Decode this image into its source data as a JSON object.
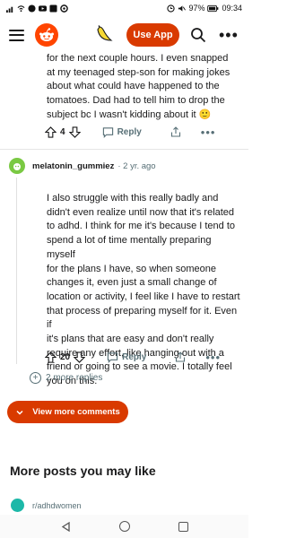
{
  "status_bar": {
    "battery": "97%",
    "time": "09:34"
  },
  "header": {
    "use_app_label": "Use App",
    "menu_icon": "hamburger-icon",
    "logo_icon": "reddit-logo",
    "search_icon": "search-icon",
    "more_icon": "more-icon"
  },
  "comment1": {
    "lines": [
      "for the next couple hours. I even snapped",
      "at my teenaged step-son for making jokes",
      "about what could have happened to the",
      "tomatoes. Dad had to tell him to drop the",
      "subject bc I wasn't kidding about it 🙂"
    ],
    "votes": "4",
    "reply_label": "Reply"
  },
  "comment2": {
    "username": "melatonin_gummiez",
    "age": "2 yr. ago",
    "lines": [
      "I also struggle with this really badly and",
      "didn't even realize until now that it's related",
      "to adhd. I think for me it's because I tend to",
      "spend a lot of time mentally preparing myself",
      "for the plans I have, so when someone",
      "changes it, even just a small change of",
      "location or activity, I feel like I have to restart",
      "that process of preparing myself for it. Even if",
      "it's plans that are easy and don't really",
      "require any effort, like hanging out with a",
      "friend or going to see a movie. I totally feel",
      "you on this."
    ],
    "votes": "20",
    "reply_label": "Reply",
    "more_replies": "2 more replies"
  },
  "view_more_comments": "View more comments",
  "more_posts_title": "More posts you may like",
  "suggested_subreddit": "r/adhdwomen",
  "colors": {
    "accent": "#d93a00",
    "reddit_orange": "#ff4500"
  }
}
